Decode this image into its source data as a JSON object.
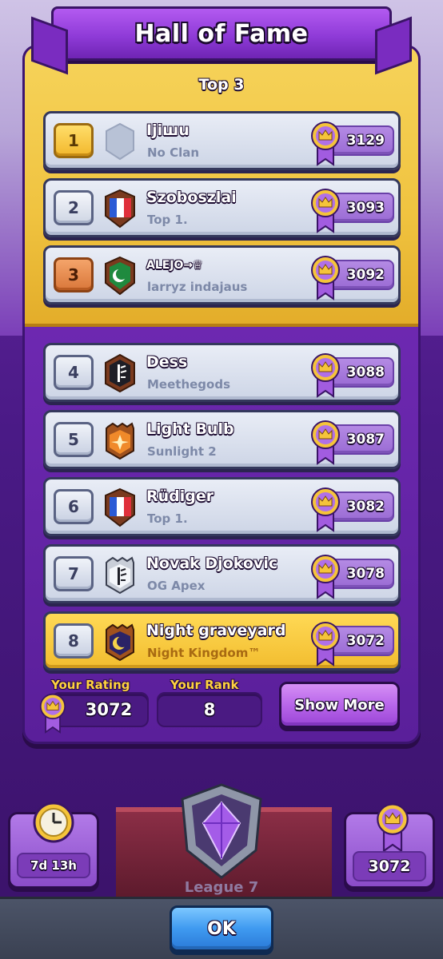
{
  "title": "Hall of Fame",
  "top3_label": "Top 3",
  "players": [
    {
      "rank": "1",
      "name": "Ijiшu",
      "clan": "No Clan",
      "trophies": "3129"
    },
    {
      "rank": "2",
      "name": "Szoboszlai",
      "clan": "Top 1.",
      "trophies": "3093"
    },
    {
      "rank": "3",
      "name": "ALEJO→♕",
      "clan": "larryz indajaus",
      "trophies": "3092"
    },
    {
      "rank": "4",
      "name": "Dess",
      "clan": "Meethegods",
      "trophies": "3088"
    },
    {
      "rank": "5",
      "name": "Light Bulb",
      "clan": "Sunlight 2",
      "trophies": "3087"
    },
    {
      "rank": "6",
      "name": "Rüdiger",
      "clan": "Top 1.",
      "trophies": "3082"
    },
    {
      "rank": "7",
      "name": "Novak Djokovic",
      "clan": "OG Apex",
      "trophies": "3078"
    },
    {
      "rank": "8",
      "name": "Night graveyard",
      "clan": "Night Kingdom™",
      "trophies": "3072"
    }
  ],
  "your_rating_label": "Your Rating",
  "your_rating": "3072",
  "your_rank_label": "Your Rank",
  "your_rank": "8",
  "show_more_label": "Show More",
  "timer": "7d 13h",
  "league_label": "League 7",
  "right_card_trophies": "3072",
  "ok_label": "OK",
  "colors": {
    "gold": "#f2c33d",
    "purple": "#6a28b0",
    "ok_blue": "#3f9af0"
  }
}
